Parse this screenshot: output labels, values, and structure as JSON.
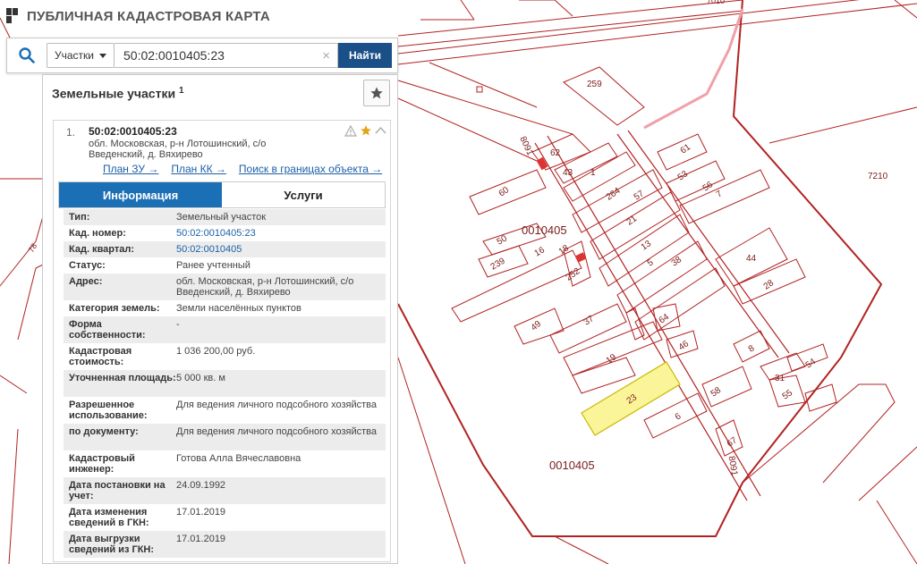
{
  "app": {
    "title": "ПУБЛИЧНАЯ КАДАСТРОВАЯ КАРТА"
  },
  "search": {
    "type_label": "Участки",
    "query": "50:02:0010405:23",
    "find_label": "Найти"
  },
  "panel": {
    "title": "Земельные участки",
    "count": "1"
  },
  "result": {
    "index": "1.",
    "cad_number": "50:02:0010405:23",
    "address": "обл. Московская, р-н Лотошинский, с/о Введенский, д. Вяхирево",
    "links": [
      "План ЗУ →",
      "План КК →",
      "Поиск в границах объекта →"
    ],
    "tabs": [
      "Информация",
      "Услуги"
    ],
    "rows": [
      {
        "key": "Тип:",
        "value": "Земельный участок"
      },
      {
        "key": "Кад. номер:",
        "value": "50:02:0010405:23"
      },
      {
        "key": "Кад. квартал:",
        "value": "50:02:0010405"
      },
      {
        "key": "Статус:",
        "value": "Ранее учтенный"
      },
      {
        "key": "Адрес:",
        "value": "обл. Московская, р-н Лотошинский, с/о Введенский, д. Вяхирево"
      },
      {
        "key": "Категория земель:",
        "value": "Земли населённых пунктов"
      },
      {
        "key": "Форма собственности:",
        "value": "-"
      },
      {
        "key": "Кадастровая стоимость:",
        "value": "1 036 200,00 руб."
      },
      {
        "key": "Уточненная площадь:",
        "value": "5 000 кв. м"
      },
      {
        "key": "Разрешенное использование:",
        "value": "Для ведения личного подсобного хозяйства"
      },
      {
        "key": "по документу:",
        "value": "Для ведения личного подсобного хозяйства"
      },
      {
        "key": "Кадастровый инженер:",
        "value": "Готова Алла Вячеславовна"
      },
      {
        "key": "Дата постановки на учет:",
        "value": "24.09.1992"
      },
      {
        "key": "Дата изменения сведений в ГКН:",
        "value": "17.01.2019"
      },
      {
        "key": "Дата выгрузки сведений из ГКН:",
        "value": "17.01.2019"
      }
    ]
  },
  "map": {
    "quarter_labels": [
      "0010405",
      "0010405"
    ],
    "road_labels": [
      "8091",
      "8091"
    ],
    "area_labels": [
      "7210",
      "7010",
      "78"
    ],
    "parcel_labels": [
      "259",
      "62",
      "43",
      "1",
      "264",
      "57",
      "61",
      "53",
      "56",
      "7",
      "60",
      "21",
      "50",
      "239",
      "16",
      "13",
      "18",
      "252",
      "5",
      "38",
      "44",
      "28",
      "49",
      "37",
      "64",
      "19",
      "46",
      "8",
      "23",
      "58",
      "6",
      "67",
      "31",
      "54",
      "55"
    ]
  }
}
